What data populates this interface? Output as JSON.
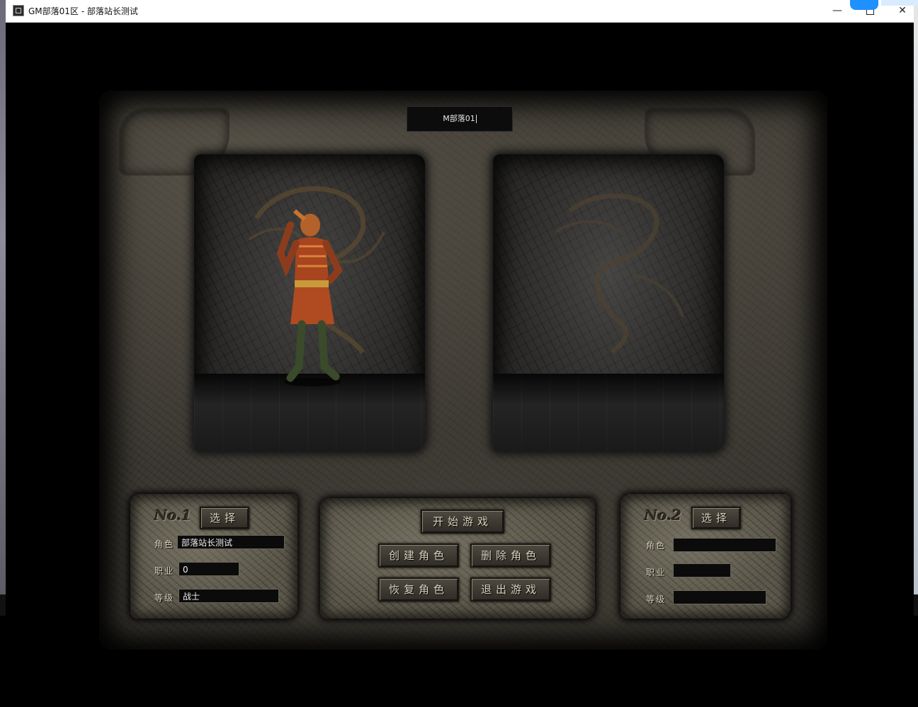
{
  "window": {
    "title": "GM部落01区 - 部落站长测试",
    "minimize_glyph": "—",
    "close_glyph": "✕"
  },
  "game": {
    "server_name": "M部落01",
    "actions": {
      "start": "开始游戏",
      "create": "创建角色",
      "delete": "删除角色",
      "restore": "恢复角色",
      "exit": "退出游戏"
    },
    "slot1": {
      "number": "No.1",
      "select_label": "选择",
      "role_label": "角色",
      "role_value": "部落站长测试",
      "job_label": "职业",
      "job_value": "0",
      "level_label": "等级",
      "level_value": "战士"
    },
    "slot2": {
      "number": "No.2",
      "select_label": "选择",
      "role_label": "角色",
      "role_value": "",
      "job_label": "职业",
      "job_value": "",
      "level_label": "等级",
      "level_value": ""
    }
  },
  "icons": {
    "app": "game-app-icon",
    "character": "warrior-character-sprite",
    "emblem": "dragon-emblem"
  },
  "colors": {
    "stone": "#3a3731",
    "button_text": "#d9d2bd",
    "field_bg": "#0b0b0b"
  }
}
